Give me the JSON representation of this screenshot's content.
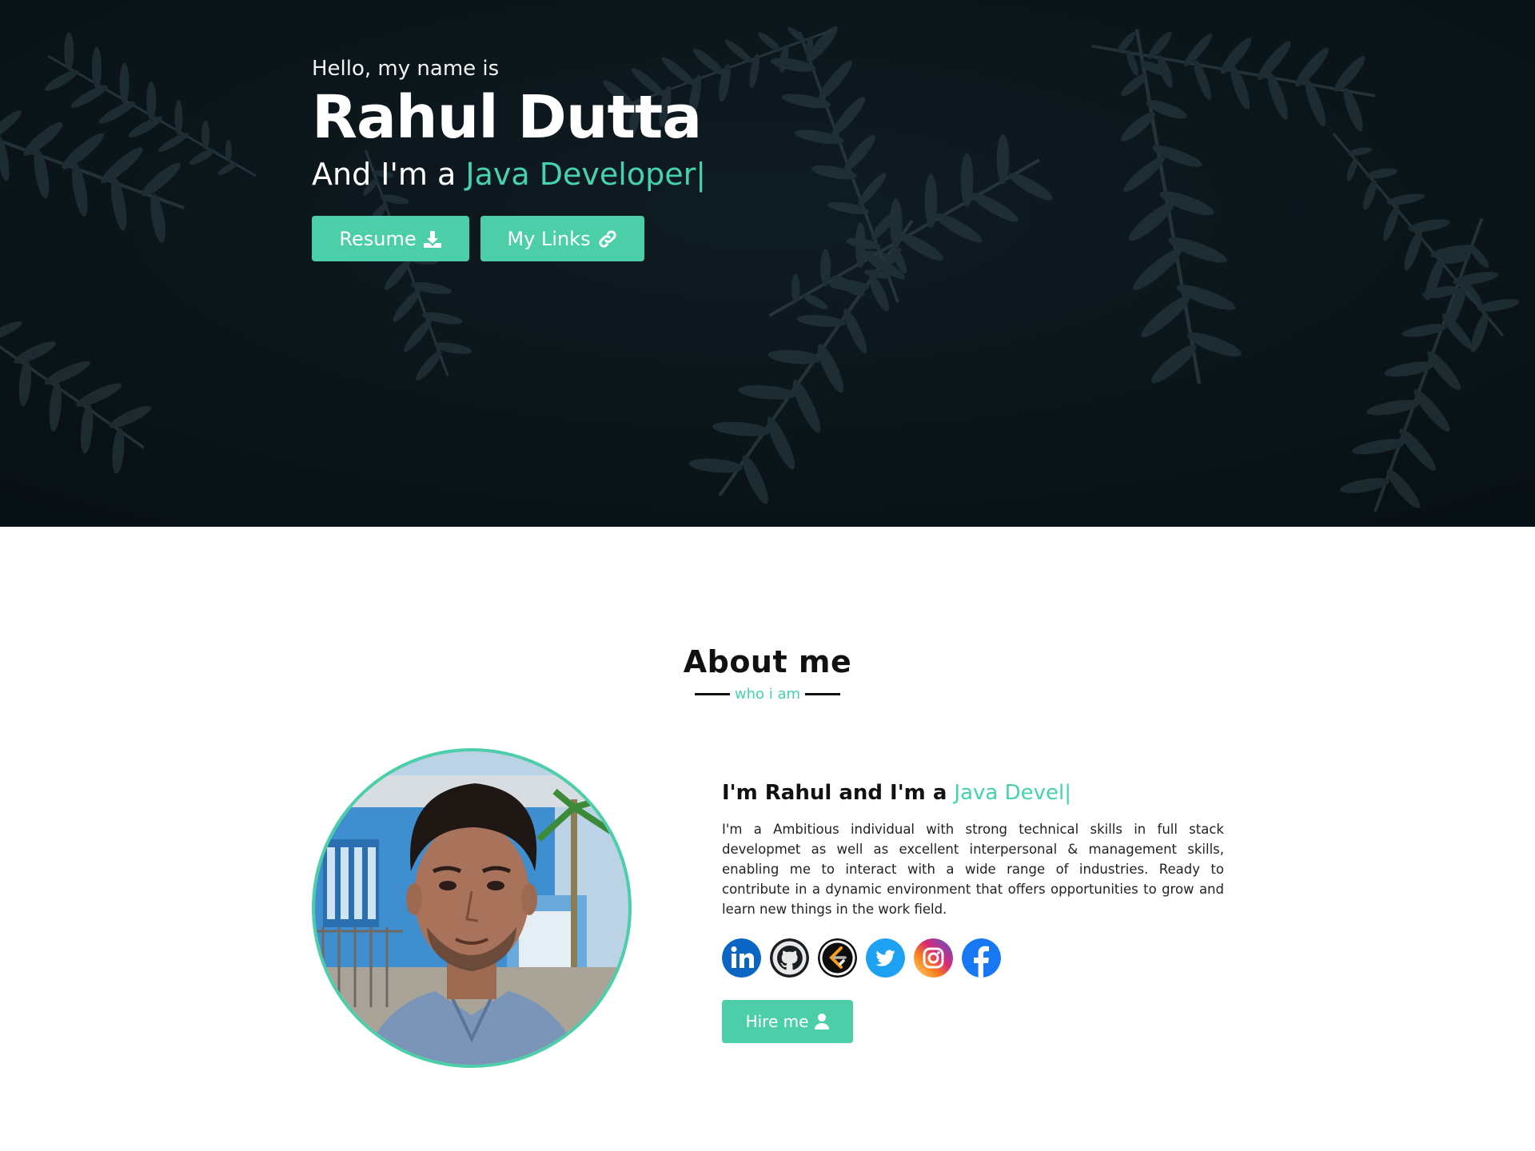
{
  "hero": {
    "greeting": "Hello, my name is",
    "name": "Rahul Dutta",
    "role_prefix": "And I'm a ",
    "role_accent": "Java Developer",
    "cursor": "|",
    "buttons": {
      "resume": "Resume",
      "links": "My Links"
    }
  },
  "about": {
    "title": "About me",
    "subtitle": "who i am",
    "heading_prefix": "I'm Rahul and I'm a ",
    "heading_accent": "Java Devel",
    "cursor": "|",
    "description": "I'm a Ambitious individual with strong technical skills in full stack developmet as well as excellent interpersonal & management skills, enabling me to interact with a wide range of industries. Ready to contribute in a dynamic environment that offers opportunities to grow and learn new things in the work field.",
    "hire_button": "Hire me",
    "social_links": [
      "linkedin-icon",
      "github-icon",
      "leetcode-icon",
      "twitter-icon",
      "instagram-icon",
      "facebook-icon"
    ]
  },
  "colors": {
    "accent": "#4ccfa8",
    "hero_bg": "#0c161b",
    "text_dark": "#111111"
  }
}
